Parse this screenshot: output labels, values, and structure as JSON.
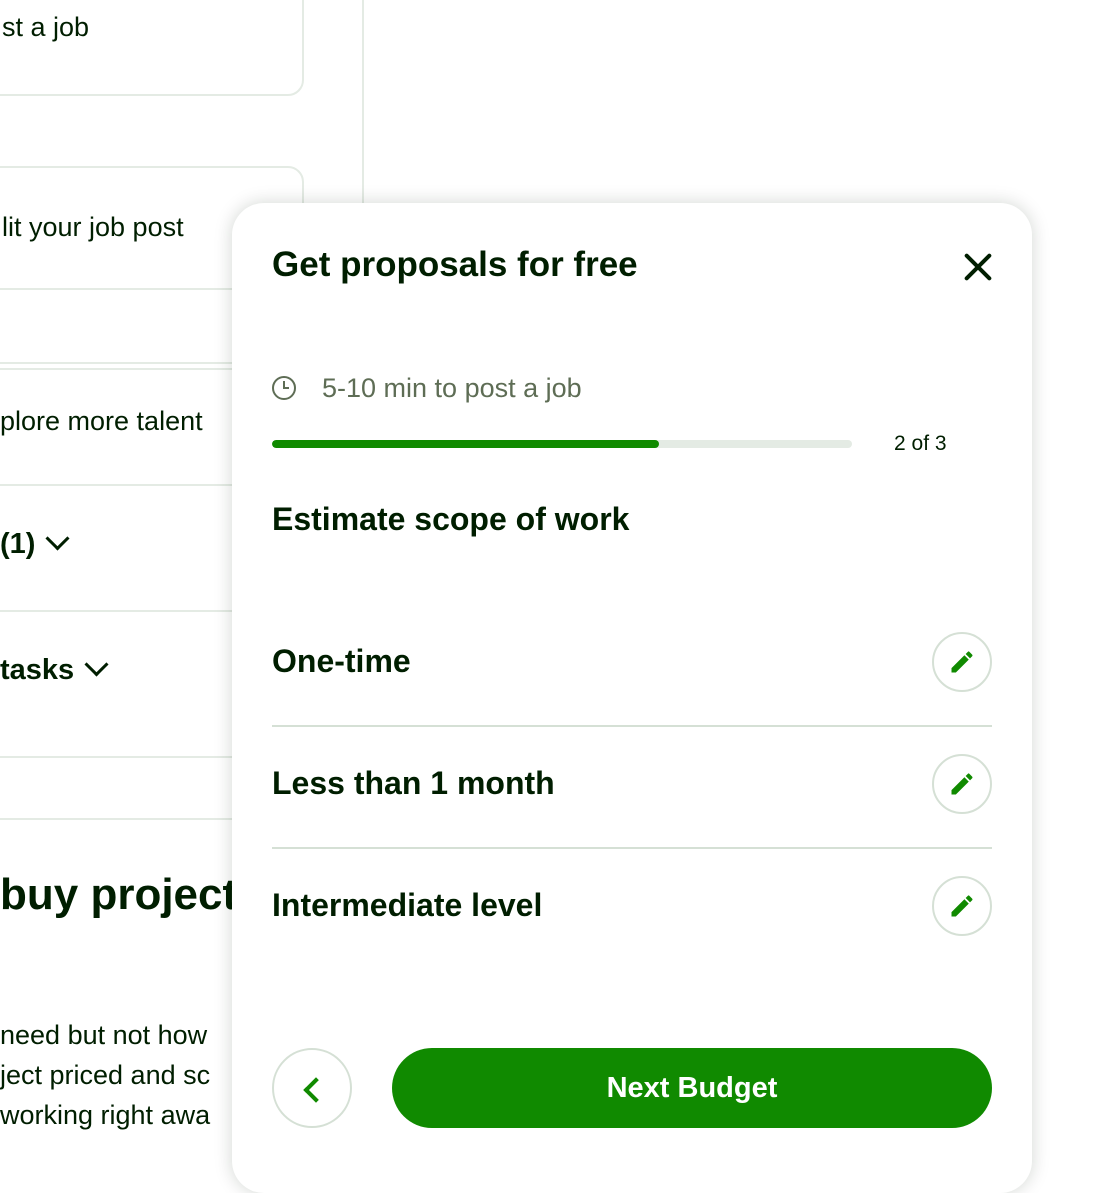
{
  "background": {
    "card1_text": "st a job",
    "card2_text": "lit your job post",
    "row_explore": "plore more talent",
    "row_filter": "(1)",
    "row_tasks": "tasks",
    "heading": "buy projects",
    "body_lines": [
      "need but not how",
      "ject priced and sc",
      "working right awa"
    ]
  },
  "modal": {
    "title": "Get proposals for free",
    "time_estimate": "5-10 min to post a job",
    "progress": {
      "current": 2,
      "total": 3,
      "fraction": 0.667,
      "label": "2 of 3"
    },
    "section_title": "Estimate scope of work",
    "rows": [
      {
        "label": "One-time",
        "icon": "pencil-icon"
      },
      {
        "label": "Less than 1 month",
        "icon": "pencil-icon"
      },
      {
        "label": "Intermediate level",
        "icon": "pencil-icon"
      }
    ],
    "next_button_label": "Next Budget",
    "colors": {
      "accent": "#108a00",
      "text": "#001e00",
      "muted": "#5e6d55",
      "divider": "#d5e0d5"
    }
  }
}
